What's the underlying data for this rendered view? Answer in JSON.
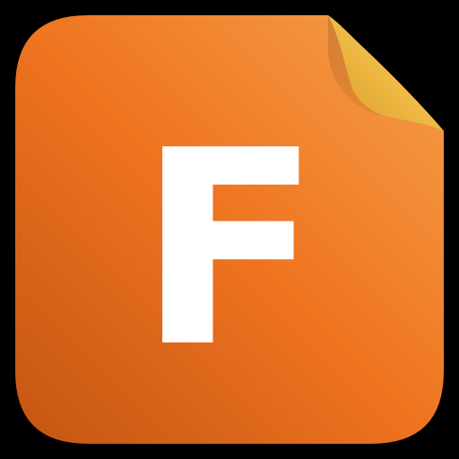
{
  "app_icon": {
    "letter": "F",
    "icon_name": "document-file-icon",
    "colors": {
      "background": "#000000",
      "orange_light": "#F5A04A",
      "orange_mid": "#EF7420",
      "orange_dark": "#C35512",
      "fold_light": "#FCE7A0",
      "fold_mid": "#F1BE4A",
      "fold_dark": "#D99A22",
      "letter": "#FFFFFF"
    }
  }
}
